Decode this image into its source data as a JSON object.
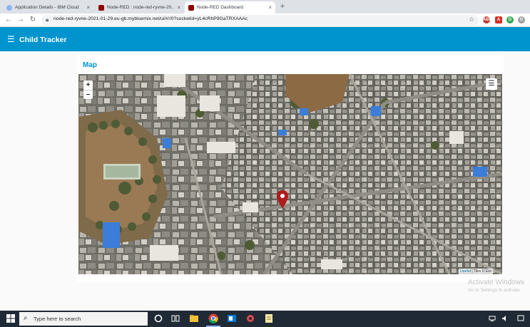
{
  "browser": {
    "tabs": [
      {
        "title": "Application Details - IBM Cloud",
        "fav_color": "#8ab4f8",
        "close": "×"
      },
      {
        "title": "Node-RED : node-red-ryvne-20...",
        "fav_color": "#8f0000",
        "close": "×"
      },
      {
        "title": "Node-RED Dashboard",
        "fav_color": "#8f0000",
        "close": "×"
      }
    ],
    "new_tab": "+",
    "url": "node-red-ryvne-2021-01-29.eu-gb.mybluemix.net/ui/#!/0?socketid=yL4cRhP9GaTRXAAAc",
    "back": "←",
    "forward": "→",
    "reload": "↻",
    "lock": "🔒",
    "star": "☆",
    "extensions": [
      {
        "label": "ABP",
        "color": "#c0392b"
      },
      {
        "label": "A",
        "color": "#d93025"
      },
      {
        "label": "S",
        "color": "#e67e22"
      },
      {
        "label": "G",
        "color": "#34a853"
      },
      {
        "label": "O",
        "color": "#a0a0a0"
      }
    ]
  },
  "app": {
    "menu_icon": "☰",
    "title": "Child Tracker",
    "accent": "#0094ce"
  },
  "card": {
    "title": "Map"
  },
  "map": {
    "zoom_in": "+",
    "zoom_out": "−",
    "layers_icon": "☰",
    "attribution_link": "Leaflet",
    "attribution_text": " | Tiles © Esri",
    "marker_color": "#b01c1c"
  },
  "watermark": {
    "line1": "Activate Windows",
    "line2": "Go to Settings to activate"
  },
  "taskbar": {
    "search_placeholder": "Type here to search",
    "search_icon": "⌕"
  }
}
